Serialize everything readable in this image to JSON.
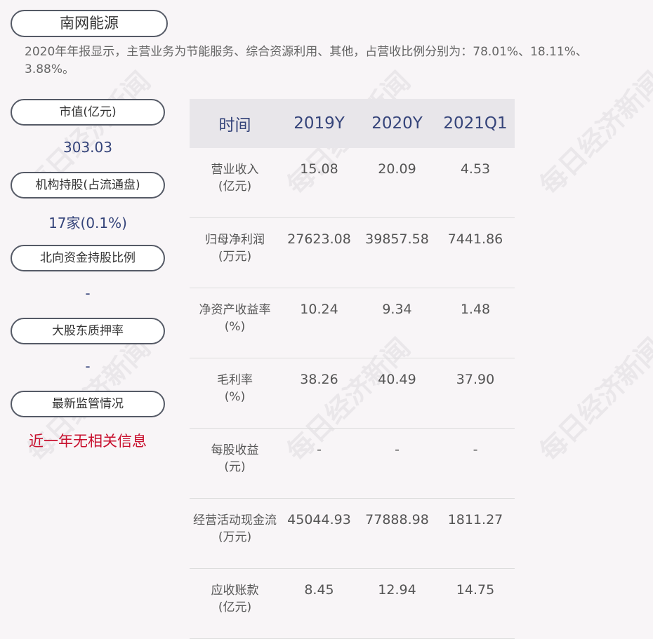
{
  "company": "南网能源",
  "summary": "2020年年报显示，主营业务为节能服务、综合资源利用、其他，占营收比例分别为：78.01%、18.11%、3.88%。",
  "metrics": [
    {
      "label": "市值(亿元)",
      "value": "303.03"
    },
    {
      "label": "机构持股(占流通盘)",
      "value": "17家(0.1%)"
    },
    {
      "label": "北向资金持股比例",
      "value": "-"
    },
    {
      "label": "大股东质押率",
      "value": "-"
    },
    {
      "label": "最新监管情况",
      "value": "近一年无相关信息"
    }
  ],
  "table": {
    "headers": [
      "时间",
      "2019Y",
      "2020Y",
      "2021Q1"
    ],
    "rows": [
      {
        "label1": "营业收入",
        "label2": "(亿元)",
        "v": [
          "15.08",
          "20.09",
          "4.53"
        ]
      },
      {
        "label1": "归母净利润",
        "label2": "(万元)",
        "v": [
          "27623.08",
          "39857.58",
          "7441.86"
        ]
      },
      {
        "label1": "净资产收益率",
        "label2": "(%)",
        "v": [
          "10.24",
          "9.34",
          "1.48"
        ]
      },
      {
        "label1": "毛利率",
        "label2": "(%)",
        "v": [
          "38.26",
          "40.49",
          "37.90"
        ]
      },
      {
        "label1": "每股收益",
        "label2": "(元)",
        "v": [
          "-",
          "-",
          "-"
        ]
      },
      {
        "label1": "经营活动现金流",
        "label2": "(万元)",
        "v": [
          "45044.93",
          "77888.98",
          "1811.27"
        ]
      },
      {
        "label1": "应收账款",
        "label2": "(亿元)",
        "v": [
          "8.45",
          "12.94",
          "14.75"
        ]
      }
    ]
  },
  "watermark": "每日经济新闻"
}
